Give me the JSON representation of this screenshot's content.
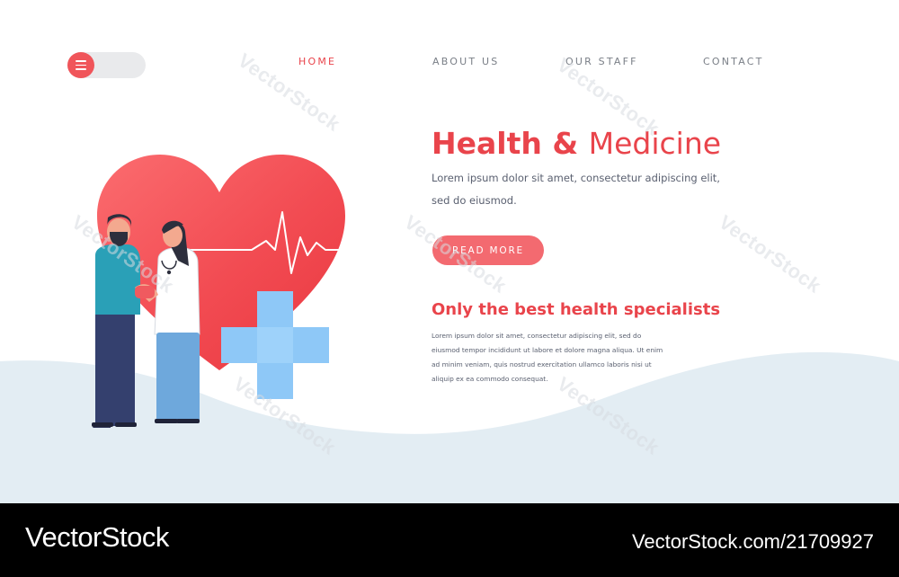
{
  "nav": {
    "items": [
      {
        "label": "HOME",
        "active": true
      },
      {
        "label": "ABOUT US",
        "active": false
      },
      {
        "label": "OUR STAFF",
        "active": false
      },
      {
        "label": "CONTACT",
        "active": false
      }
    ],
    "menu_icon": "hamburger-menu-icon"
  },
  "hero": {
    "title_bold": "Health &",
    "title_light": "Medicine",
    "description": "Lorem ipsum dolor sit amet, consectetur adipiscing elit, sed do eiusmod.",
    "button_label": "READ MORE"
  },
  "section": {
    "title": "Only the best health specialists",
    "text": "Lorem ipsum dolor sit amet, consectetur adipiscing elit, sed do eiusmod tempor incididunt ut labore et dolore magna aliqua. Ut enim ad minim veniam, quis nostrud exercitation ullamco laboris nisi ut aliquip ex ea commodo consequat."
  },
  "illustration": {
    "icons": [
      "heart-icon",
      "heartbeat-line-icon",
      "medical-cross-icon",
      "doctor-figure",
      "patient-figure"
    ]
  },
  "watermark": "VectorStock",
  "footer": {
    "brand": "VectorStock",
    "image_ref": "VectorStock.com/21709927"
  },
  "colors": {
    "accent": "#e9444b",
    "button": "#f36a70",
    "cross": "#8ec8f7",
    "wave": "#e3edf3"
  }
}
